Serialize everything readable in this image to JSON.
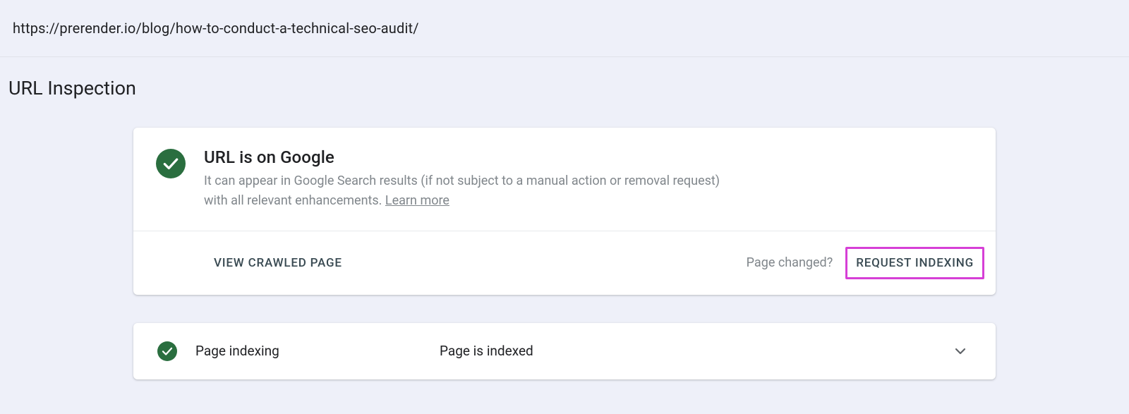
{
  "url_bar": "https://prerender.io/blog/how-to-conduct-a-technical-seo-audit/",
  "page_title": "URL Inspection",
  "status": {
    "heading": "URL is on Google",
    "desc_prefix": "It can appear in Google Search results (if not subject to a manual action or removal request) with all relevant enhancements. ",
    "learn_more": "Learn more"
  },
  "actions": {
    "view_crawled": "VIEW CRAWLED PAGE",
    "page_changed": "Page changed?",
    "request_indexing": "REQUEST INDEXING"
  },
  "indexing": {
    "label": "Page indexing",
    "status": "Page is indexed"
  }
}
